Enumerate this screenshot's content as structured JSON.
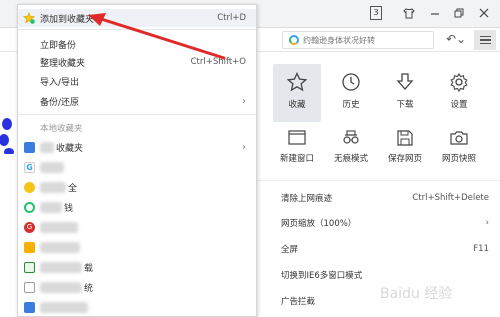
{
  "window": {
    "tab_count": "3",
    "controls": [
      "shirt-icon",
      "minimize-icon",
      "restore-icon",
      "close-icon"
    ]
  },
  "addressbar": {
    "search_placeholder": "约翰逊身体状况好转"
  },
  "bookmark_menu": {
    "items": [
      {
        "label": "添加到收藏夹",
        "shortcut": "Ctrl+D"
      },
      {
        "label": "立即备份",
        "shortcut": ""
      },
      {
        "label": "整理收藏夹",
        "shortcut": "Ctrl+Shift+O"
      },
      {
        "label": "导入/导出",
        "shortcut": ""
      },
      {
        "label": "备份/还原",
        "shortcut": ""
      }
    ],
    "local_section_title": "本地收藏夹",
    "favorites": [
      {
        "text": "收藏夹",
        "icon_color": "#3b7ddd"
      },
      {
        "text": "",
        "icon_color": "#2ca5f5"
      },
      {
        "text": "全",
        "icon_color": "#f5c518"
      },
      {
        "text": "钱",
        "icon_color": "#23c16b"
      },
      {
        "text": "",
        "icon_color": "#d32f2f"
      },
      {
        "text": "",
        "icon_color": "#f5b000"
      },
      {
        "text": "载",
        "icon_color": "#2a8a3a"
      },
      {
        "text": "统",
        "icon_color": "#9e9e9e"
      },
      {
        "text": "",
        "icon_color": "#3b7ddd"
      }
    ]
  },
  "browser_menu": {
    "top_icons": [
      {
        "label": "收藏",
        "icon": "star-icon"
      },
      {
        "label": "历史",
        "icon": "clock-icon"
      },
      {
        "label": "下载",
        "icon": "download-icon"
      },
      {
        "label": "设置",
        "icon": "gear-icon"
      }
    ],
    "second_icons": [
      {
        "label": "新建窗口",
        "icon": "window-icon"
      },
      {
        "label": "无痕模式",
        "icon": "glasses-icon"
      },
      {
        "label": "保存网页",
        "icon": "save-icon"
      },
      {
        "label": "网页快照",
        "icon": "camera-icon"
      }
    ],
    "rows": [
      {
        "label": "清除上网痕迹",
        "right": "Ctrl+Shift+Delete"
      },
      {
        "label": "网页缩放（100%）",
        "right": "›"
      },
      {
        "label": "全屏",
        "right": "F11"
      },
      {
        "label": "切换到IE6多窗口模式",
        "right": ""
      },
      {
        "label": "广告拦截",
        "right": ""
      }
    ]
  },
  "colors": {
    "arrow": "#e02a2a",
    "highlight": "#eef1f6",
    "active_icon_bg": "#e4e7ec"
  }
}
